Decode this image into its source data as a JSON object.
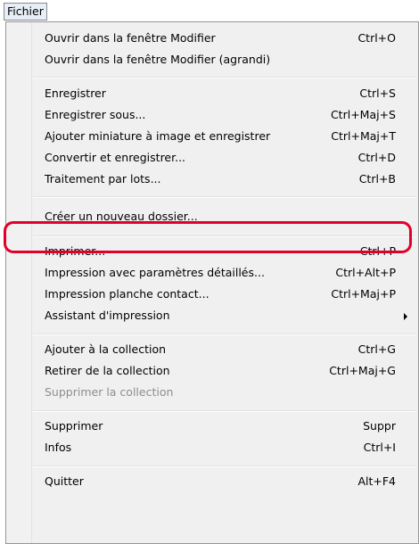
{
  "menubar": {
    "title": "Fichier"
  },
  "menu": {
    "items": [
      {
        "label": "Ouvrir dans la fenêtre Modifier",
        "shortcut": "Ctrl+O"
      },
      {
        "label": "Ouvrir dans la fenêtre Modifier (agrandi)",
        "shortcut": ""
      },
      {
        "label": "Enregistrer",
        "shortcut": "Ctrl+S"
      },
      {
        "label": "Enregistrer sous...",
        "shortcut": "Ctrl+Maj+S"
      },
      {
        "label": "Ajouter miniature à image et enregistrer",
        "shortcut": "Ctrl+Maj+T"
      },
      {
        "label": "Convertir et enregistrer...",
        "shortcut": "Ctrl+D"
      },
      {
        "label": "Traitement par lots...",
        "shortcut": "Ctrl+B"
      },
      {
        "label": "Créer un nouveau dossier...",
        "shortcut": ""
      },
      {
        "label": "Imprimer...",
        "shortcut": "Ctrl+P"
      },
      {
        "label": "Impression avec paramètres détaillés...",
        "shortcut": "Ctrl+Alt+P"
      },
      {
        "label": "Impression planche contact...",
        "shortcut": "Ctrl+Maj+P"
      },
      {
        "label": "Assistant d'impression",
        "shortcut": ""
      },
      {
        "label": "Ajouter à la collection",
        "shortcut": "Ctrl+G"
      },
      {
        "label": "Retirer de la collection",
        "shortcut": "Ctrl+Maj+G"
      },
      {
        "label": "Supprimer la collection",
        "shortcut": "",
        "disabled": true
      },
      {
        "label": "Supprimer",
        "shortcut": "Suppr"
      },
      {
        "label": "Infos",
        "shortcut": "Ctrl+I"
      },
      {
        "label": "Quitter",
        "shortcut": "Alt+F4"
      }
    ]
  },
  "highlight": {
    "color": "#e0002a",
    "target": "Créer un nouveau dossier..."
  }
}
